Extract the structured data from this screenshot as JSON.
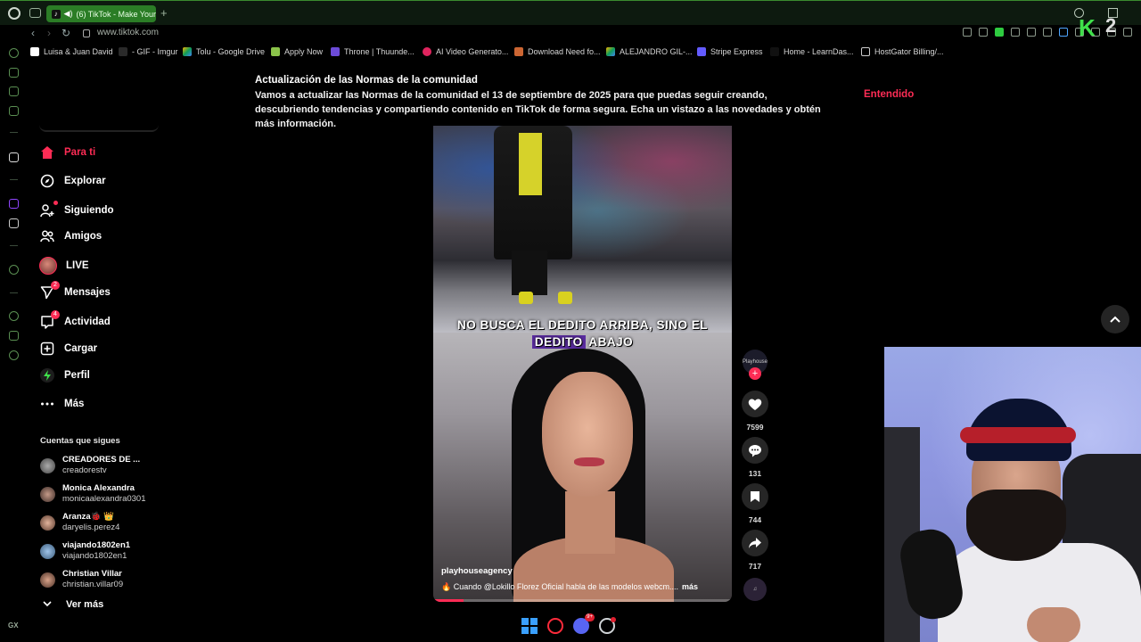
{
  "browser": {
    "tab_title": "(6) TikTok - Make Your",
    "url": "www.tiktok.com",
    "bookmarks": [
      "Luisa & Juan David",
      "- GIF - Imgur",
      "Tolu - Google Drive",
      "Apply Now",
      "Throne | Thuunde...",
      "AI Video Generato...",
      "Download Need fo...",
      "ALEJANDRO GIL-...",
      "Stripe Express",
      "Home - LearnDas...",
      "HostGator Billing/..."
    ],
    "sidebar_label_gx": "GX"
  },
  "nav": {
    "items": [
      {
        "label": "Para ti",
        "icon": "home-icon"
      },
      {
        "label": "Explorar",
        "icon": "compass-icon"
      },
      {
        "label": "Siguiendo",
        "icon": "following-icon"
      },
      {
        "label": "Amigos",
        "icon": "friends-icon"
      },
      {
        "label": "LIVE",
        "icon": "live-avatar"
      },
      {
        "label": "Mensajes",
        "icon": "send-icon",
        "badge": "2"
      },
      {
        "label": "Actividad",
        "icon": "activity-icon",
        "badge": "4"
      },
      {
        "label": "Cargar",
        "icon": "upload-icon"
      },
      {
        "label": "Perfil",
        "icon": "profile-icon"
      },
      {
        "label": "Más",
        "icon": "more-icon"
      }
    ]
  },
  "following": {
    "title": "Cuentas que sigues",
    "accounts": [
      {
        "name": "CREADORES DE ...",
        "handle": "creadorestv"
      },
      {
        "name": "Monica Alexandra",
        "handle": "monicaalexandra0301"
      },
      {
        "name": "Aranza🐞 👑",
        "handle": "daryelis.perez4"
      },
      {
        "name": "viajando1802en1",
        "handle": "viajando1802en1"
      },
      {
        "name": "Christian Villar",
        "handle": "christian.villar09"
      }
    ],
    "see_more": "Ver más"
  },
  "notice": {
    "title": "Actualización de las Normas de la comunidad",
    "body": "Vamos a actualizar las Normas de la comunidad el 13 de septiembre de 2025 para que puedas seguir creando, descubriendo tendencias y compartiendo contenido en TikTok de forma segura. Echa un vistazo a las novedades y obtén más información.",
    "action": "Entendido"
  },
  "video": {
    "caption_line1": "NO BUSCA EL DEDITO ARRIBA, SINO EL",
    "caption_line2_highlight": "DEDITO",
    "caption_line2_rest": " ABAJO",
    "author": "playhouseagency",
    "description": "🔥 Cuando @Lokillo Florez Oficial  habla de las modelos webcm....",
    "more": "más",
    "progress": 0.1
  },
  "actions": {
    "likes": "7599",
    "comments": "131",
    "saves": "744",
    "shares": "717",
    "creator_avatar_text": "Playhouse"
  },
  "colors": {
    "accent": "#fe2c55",
    "opera_green": "#2b7d26"
  }
}
